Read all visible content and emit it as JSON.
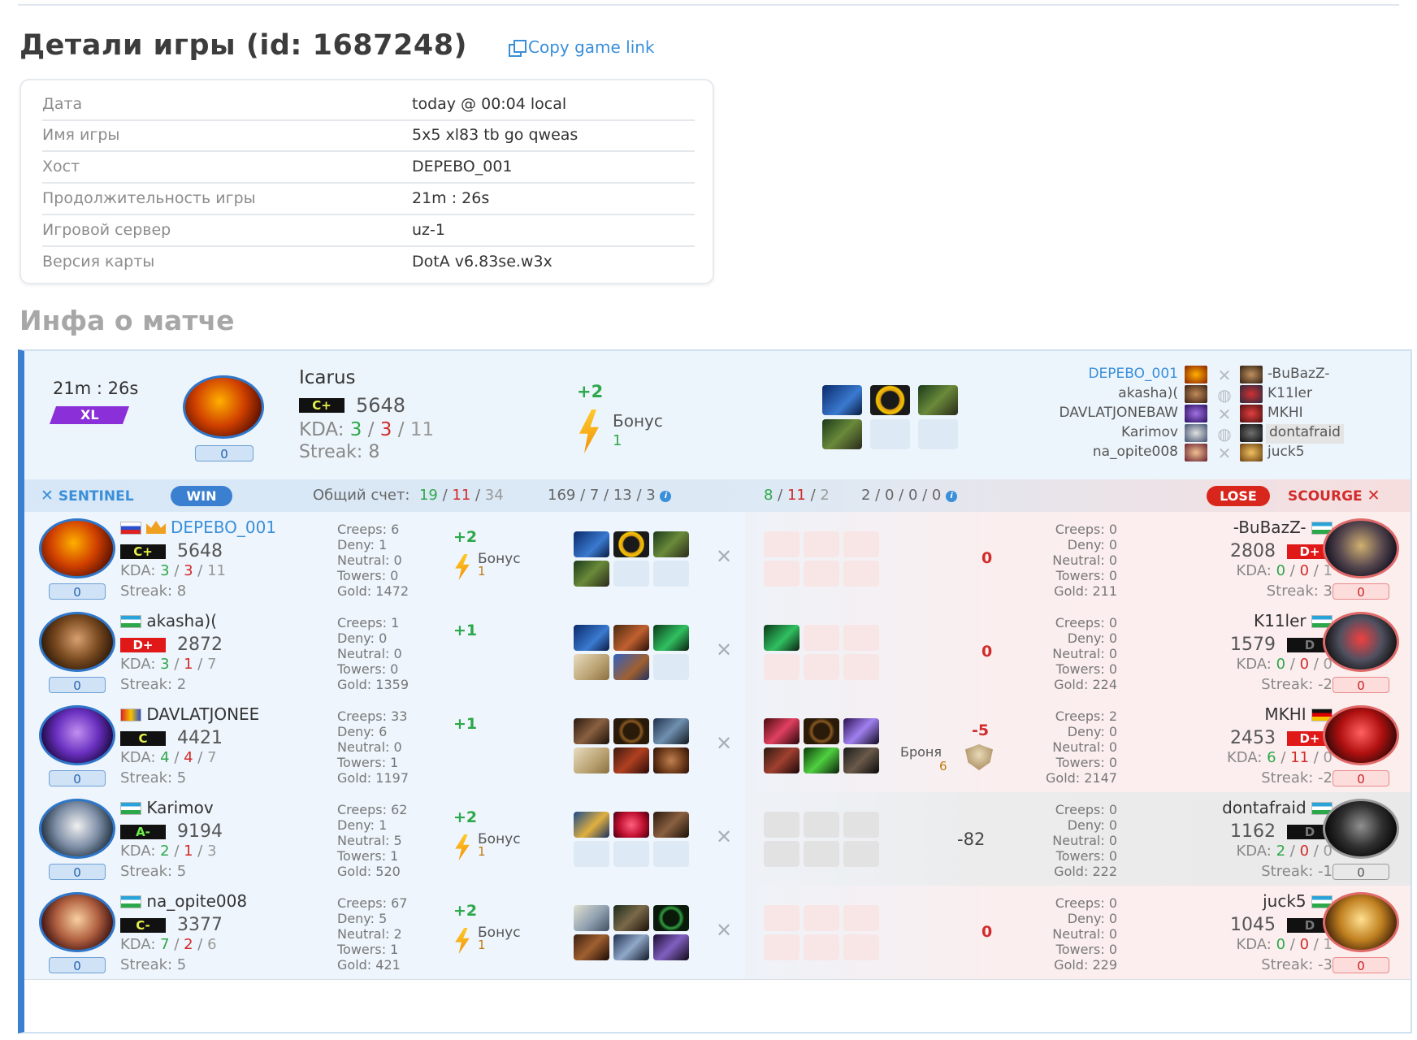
{
  "title": "Детали игры (id: 1687248)",
  "copy_link": "Copy game link",
  "details": [
    {
      "k": "Дата",
      "v": "today @ 00:04 local"
    },
    {
      "k": "Имя игры",
      "v": "5x5 xl83 tb go qweas"
    },
    {
      "k": "Хост",
      "v": "DEPEBO_001"
    },
    {
      "k": "Продолжительность игры",
      "v": "21m : 26s"
    },
    {
      "k": "Игровой сервер",
      "v": "uz-1"
    },
    {
      "k": "Версия карты",
      "v": "DotA v6.83se.w3x"
    }
  ],
  "section_title": "Инфа о матче",
  "summary": {
    "duration": "21m : 26s",
    "mode": "XL",
    "zero": "0",
    "player": "Icarus",
    "rank": "C+",
    "mmr": "5648",
    "kda_label": "KDA:",
    "k": "3",
    "d": "3",
    "a": "11",
    "streak": "Streak: 8",
    "bonus_plus": "+2",
    "bonus_label": "Бонус",
    "bonus_num": "1",
    "roster_left": [
      "DEPEBO_001",
      "akasha)(",
      "DAVLATJONEBAW",
      "Karimov",
      "na_opite008"
    ],
    "roster_right": [
      "-BuBazZ-",
      "K11ler",
      "MKHI",
      "dontafraid",
      "juck5"
    ]
  },
  "teambar": {
    "sentinel": "SENTINEL",
    "win": "WIN",
    "total_label": "Общий счет:",
    "s_k": "19",
    "s_d": "11",
    "s_a": "34",
    "s_creeps": "169",
    "s_deny": "13",
    "s_neutral": "7",
    "s_towers": "3",
    "c_k": "8",
    "c_d": "11",
    "c_a": "2",
    "c_creeps": "2",
    "c_deny": "0",
    "c_neutral": "0",
    "c_towers": "0",
    "lose": "LOSE",
    "scourge": "SCOURGE"
  },
  "labels": {
    "kda": "KDA:",
    "creeps": "Creeps:",
    "deny": "Deny:",
    "neutral": "Neutral:",
    "towers": "Towers:",
    "gold": "Gold:",
    "bonus": "Бонус",
    "armor": "Броня"
  },
  "rows": [
    {
      "l": {
        "name": "DEPEBO_001",
        "rank": "C+",
        "mmr": "5648",
        "k": "3",
        "d": "3",
        "a": "11",
        "streak": "Streak: 8",
        "zero": "0",
        "creeps": "6",
        "deny": "1",
        "neutral": "0",
        "towers": "0",
        "gold": "1472",
        "bonus": "+2",
        "bonus_num": "1"
      },
      "diff": "0",
      "r": {
        "name": "-BuBazZ-",
        "rank": "D+",
        "mmr": "2808",
        "k": "0",
        "d": "0",
        "a": "1",
        "streak": "Streak: 3",
        "zero": "0",
        "creeps": "0",
        "deny": "0",
        "neutral": "0",
        "towers": "0",
        "gold": "211"
      }
    },
    {
      "l": {
        "name": "akasha)(",
        "rank": "D+",
        "mmr": "2872",
        "k": "3",
        "d": "1",
        "a": "7",
        "streak": "Streak: 2",
        "zero": "0",
        "creeps": "1",
        "deny": "0",
        "neutral": "0",
        "towers": "0",
        "gold": "1359",
        "bonus": "+1"
      },
      "diff": "0",
      "r": {
        "name": "K11ler",
        "rank": "D",
        "mmr": "1579",
        "k": "0",
        "d": "0",
        "a": "0",
        "streak": "Streak: -2",
        "zero": "0",
        "creeps": "0",
        "deny": "0",
        "neutral": "0",
        "towers": "0",
        "gold": "224"
      }
    },
    {
      "l": {
        "name": "DAVLATJONEE",
        "rank": "C",
        "mmr": "4421",
        "k": "4",
        "d": "4",
        "a": "7",
        "streak": "Streak: 5",
        "zero": "0",
        "creeps": "33",
        "deny": "6",
        "neutral": "0",
        "towers": "1",
        "gold": "1197",
        "bonus": "+1"
      },
      "diff": "-5",
      "armor_num": "6",
      "r": {
        "name": "MKHI",
        "rank": "D+",
        "mmr": "2453",
        "k": "6",
        "d": "11",
        "a": "0",
        "streak": "Streak: -2",
        "zero": "0",
        "creeps": "2",
        "deny": "0",
        "neutral": "0",
        "towers": "0",
        "gold": "2147"
      }
    },
    {
      "l": {
        "name": "Karimov",
        "rank": "A-",
        "mmr": "9194",
        "k": "2",
        "d": "1",
        "a": "3",
        "streak": "Streak: 5",
        "zero": "0",
        "creeps": "62",
        "deny": "1",
        "neutral": "5",
        "towers": "1",
        "gold": "520",
        "bonus": "+2",
        "bonus_num": "1"
      },
      "diff": "-82",
      "r": {
        "name": "dontafraid",
        "rank": "D",
        "mmr": "1162",
        "k": "2",
        "d": "0",
        "a": "0",
        "streak": "Streak: -1",
        "zero": "0",
        "creeps": "0",
        "deny": "0",
        "neutral": "0",
        "towers": "0",
        "gold": "222"
      }
    },
    {
      "l": {
        "name": "na_opite008",
        "rank": "C-",
        "mmr": "3377",
        "k": "7",
        "d": "2",
        "a": "6",
        "streak": "Streak: 5",
        "zero": "0",
        "creeps": "67",
        "deny": "5",
        "neutral": "2",
        "towers": "1",
        "gold": "421",
        "bonus": "+2",
        "bonus_num": "1"
      },
      "diff": "0",
      "r": {
        "name": "juck5",
        "rank": "D",
        "mmr": "1045",
        "k": "0",
        "d": "0",
        "a": "1",
        "streak": "Streak: -3",
        "zero": "0",
        "creeps": "0",
        "deny": "0",
        "neutral": "0",
        "towers": "0",
        "gold": "229"
      }
    }
  ]
}
